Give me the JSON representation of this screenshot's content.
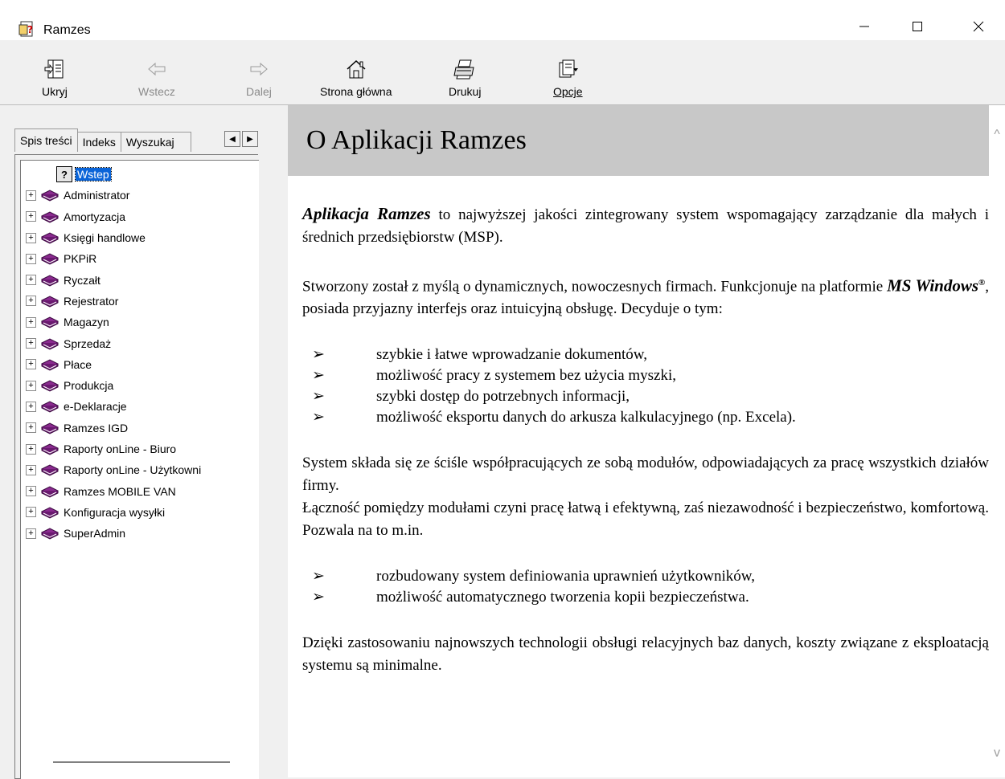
{
  "window": {
    "title": "Ramzes"
  },
  "toolbar": {
    "hide": "Ukryj",
    "back": "Wstecz",
    "forward": "Dalej",
    "home": "Strona główna",
    "print": "Drukuj",
    "options": "Opcje"
  },
  "tabs": {
    "contents": "Spis treści",
    "index": "Indeks",
    "search": "Wyszukaj"
  },
  "tree": {
    "selected": "Wstep",
    "items": [
      "Administrator",
      "Amortyzacja",
      "Księgi handlowe",
      "PKPiR",
      "Ryczałt",
      "Rejestrator",
      "Magazyn",
      "Sprzedaż",
      "Płace",
      "Produkcja",
      "e-Deklaracje",
      "Ramzes IGD",
      "Raporty onLine - Biuro",
      "Raporty onLine - Użytkowni",
      "Ramzes MOBILE VAN",
      "Konfiguracja wysyłki",
      "SuperAdmin"
    ]
  },
  "content": {
    "heading": "O Aplikacji Ramzes",
    "p1_bold": "Aplikacja Ramzes",
    "p1_rest": " to najwyższej jakości zintegrowany system wspomagający zarządzanie dla małych i średnich przedsiębiorstw (MSP).",
    "p2_a": "Stworzony został z myślą o dynamicznych, nowoczesnych firmach. Funkcjonuje na platformie ",
    "p2_bold": "MS Windows",
    "p2_reg": "®",
    "p2_b": ", posiada przyjazny interfejs oraz intuicyjną obsługę. Decyduje o tym:",
    "list1": [
      "szybkie i łatwe wprowadzanie dokumentów,",
      "możliwość pracy z systemem bez użycia myszki,",
      "szybki dostęp do potrzebnych informacji,",
      "możliwość eksportu danych do arkusza kalkulacyjnego (np. Excela)."
    ],
    "p3": "System składa się ze ściśle współpracujących ze sobą modułów, odpowiadających za pracę wszystkich działów firmy.",
    "p4": "Łączność pomiędzy modułami czyni pracę łatwą i efektywną, zaś niezawodność i bezpieczeństwo, komfortową. Pozwala na to m.in.",
    "list2": [
      "rozbudowany system definiowania uprawnień użytkowników,",
      "możliwość automatycznego tworzenia kopii bezpieczeństwa."
    ],
    "p5": "Dzięki zastosowaniu najnowszych technologii obsługi relacyjnych baz danych, koszty związane z eksploatacją systemu są minimalne.",
    "bullet": "➢"
  }
}
